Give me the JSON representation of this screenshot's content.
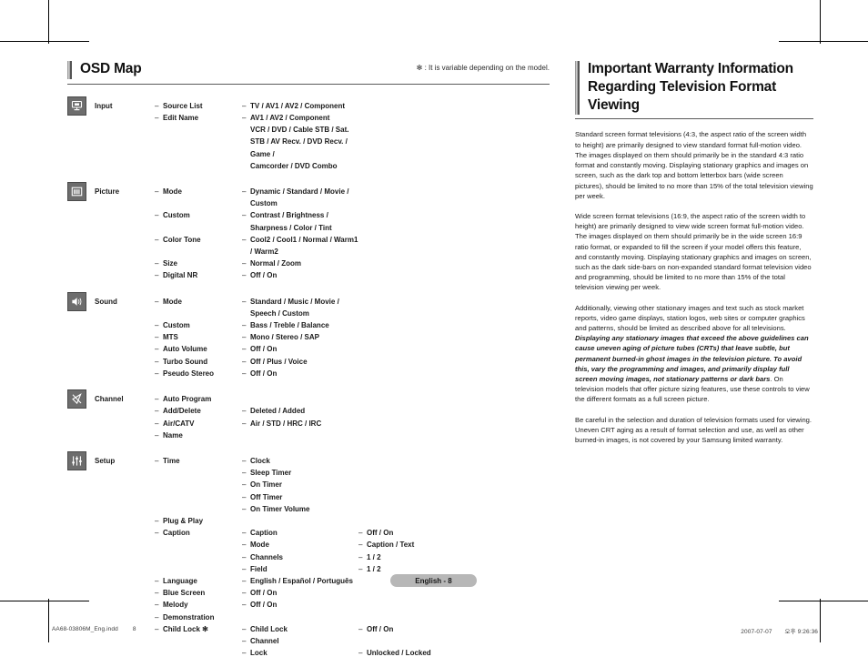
{
  "crop_marks": true,
  "left_column": {
    "title": "OSD Map",
    "note": "✻ : It is variable depending on the model.",
    "groups": [
      {
        "icon": "monitor-input-icon",
        "label": "Input",
        "rows": [
          {
            "l1": "Source List",
            "l2": "TV / AV1 / AV2 / Component",
            "l3": ""
          },
          {
            "l1": "Edit Name",
            "l2": "AV1 / AV2 / Component",
            "l3": ""
          },
          {
            "l1": "",
            "l2": "VCR / DVD / Cable STB / Sat. STB / AV Recv. / DVD Recv. / Game /",
            "l2_nodash": true,
            "l3": ""
          },
          {
            "l1": "",
            "l2": "Camcorder / DVD Combo",
            "l2_nodash": true,
            "l3": ""
          }
        ]
      },
      {
        "icon": "picture-icon",
        "label": "Picture",
        "rows": [
          {
            "l1": "Mode",
            "l2": "Dynamic / Standard / Movie / Custom"
          },
          {
            "l1": "Custom",
            "l2": "Contrast / Brightness / Sharpness / Color / Tint"
          },
          {
            "l1": "Color Tone",
            "l2": "Cool2 / Cool1 / Normal / Warm1 / Warm2"
          },
          {
            "l1": "Size",
            "l2": "Normal / Zoom"
          },
          {
            "l1": "Digital NR",
            "l2": "Off / On"
          }
        ]
      },
      {
        "icon": "speaker-icon",
        "label": "Sound",
        "rows": [
          {
            "l1": "Mode",
            "l2": "Standard / Music / Movie / Speech / Custom"
          },
          {
            "l1": "Custom",
            "l2": "Bass / Treble / Balance"
          },
          {
            "l1": "MTS",
            "l2": "Mono / Stereo / SAP"
          },
          {
            "l1": "Auto Volume",
            "l2": "Off / On"
          },
          {
            "l1": "Turbo Sound",
            "l2": "Off / Plus / Voice"
          },
          {
            "l1": "Pseudo Stereo",
            "l2": "Off / On"
          }
        ]
      },
      {
        "icon": "satellite-dish-icon",
        "label": "Channel",
        "rows": [
          {
            "l1": "Auto Program",
            "l2": ""
          },
          {
            "l1": "Add/Delete",
            "l2": "Deleted / Added"
          },
          {
            "l1": "Air/CATV",
            "l2": "Air / STD / HRC / IRC"
          },
          {
            "l1": "Name",
            "l2": ""
          }
        ]
      },
      {
        "icon": "sliders-icon",
        "label": "Setup",
        "rows": [
          {
            "l1": "Time",
            "l2": "Clock",
            "l3": ""
          },
          {
            "l1": "",
            "l2": "Sleep Timer",
            "l3": ""
          },
          {
            "l1": "",
            "l2": "On Timer",
            "l3": ""
          },
          {
            "l1": "",
            "l2": "Off Timer",
            "l3": ""
          },
          {
            "l1": "",
            "l2": "On Timer Volume",
            "l3": ""
          },
          {
            "l1": "Plug & Play",
            "l2": "",
            "l3": ""
          },
          {
            "l1": "Caption",
            "l2": "Caption",
            "l3": "Off / On"
          },
          {
            "l1": "",
            "l2": "Mode",
            "l3": "Caption / Text"
          },
          {
            "l1": "",
            "l2": "Channels",
            "l3": "1 / 2"
          },
          {
            "l1": "",
            "l2": "Field",
            "l3": "1 / 2"
          },
          {
            "l1": "Language",
            "l2": "English / Español / Português",
            "l2_wide": true,
            "l3": ""
          },
          {
            "l1": "Blue Screen",
            "l2": "Off / On",
            "l2_wide": true,
            "l3": ""
          },
          {
            "l1": "Melody",
            "l2": "Off / On",
            "l2_wide": true,
            "l3": ""
          },
          {
            "l1": "Demonstration",
            "l2": "",
            "l3": ""
          },
          {
            "l1": "Child Lock ✻",
            "l2": "Child Lock",
            "l3": "Off / On"
          },
          {
            "l1": "",
            "l2": "Channel",
            "l3": ""
          },
          {
            "l1": "",
            "l2": "Lock",
            "l3": "Unlocked / Locked"
          }
        ]
      }
    ]
  },
  "right_column": {
    "title_line1": "Important Warranty Information",
    "title_line2": "Regarding Television Format Viewing",
    "paragraphs": [
      {
        "segments": [
          {
            "text": "Standard screen format televisions (4:3, the aspect ratio of the screen width to height) are primarily designed to view standard format full-motion video. The images displayed on them should primarily be in the standard 4:3 ratio format and constantly moving. Displaying stationary graphics and images on screen, such as the dark top and bottom letterbox bars (wide screen pictures), should be limited to no more than 15% of the total television viewing per week.",
            "emphasis": false
          }
        ]
      },
      {
        "segments": [
          {
            "text": "Wide screen format televisions (16:9, the aspect ratio of the screen width to height) are primarily designed to view wide screen format full-motion video. The images displayed on them should primarily be in the wide screen 16:9 ratio format, or expanded to fill the screen if your model offers this feature, and constantly moving. Displaying stationary graphics and images on screen, such as the dark side-bars on non-expanded standard format television video and programming, should be limited to no more than 15% of the total television viewing per week.",
            "emphasis": false
          }
        ]
      },
      {
        "segments": [
          {
            "text": "Additionally, viewing other stationary images and text such as stock market reports, video game displays, station logos, web sites or computer graphics and patterns, should be limited as described above for all televisions. ",
            "emphasis": false
          },
          {
            "text": "Displaying any stationary images that exceed the above guidelines can cause uneven aging of picture tubes (CRTs) that leave subtle, but permanent burned-in ghost images in the television picture. To avoid this, vary the programming and images, and primarily display full screen moving images, not stationary patterns or dark bars",
            "emphasis": true
          },
          {
            "text": ". On television models that offer picture sizing features, use these controls to view the different formats as a full screen picture.",
            "emphasis": false
          }
        ]
      },
      {
        "segments": [
          {
            "text": "Be careful in the selection and duration of television formats used for viewing. Uneven CRT aging as a result of format selection and use, as well as other burned-in images, is not covered by your Samsung limited warranty.",
            "emphasis": false
          }
        ]
      }
    ]
  },
  "page_badge": "English - 8",
  "print_footer": {
    "file_name": "AA68-03806M_Eng.indd",
    "page_number": "8",
    "date": "2007-07-07",
    "time": "오후 9:26:36"
  }
}
